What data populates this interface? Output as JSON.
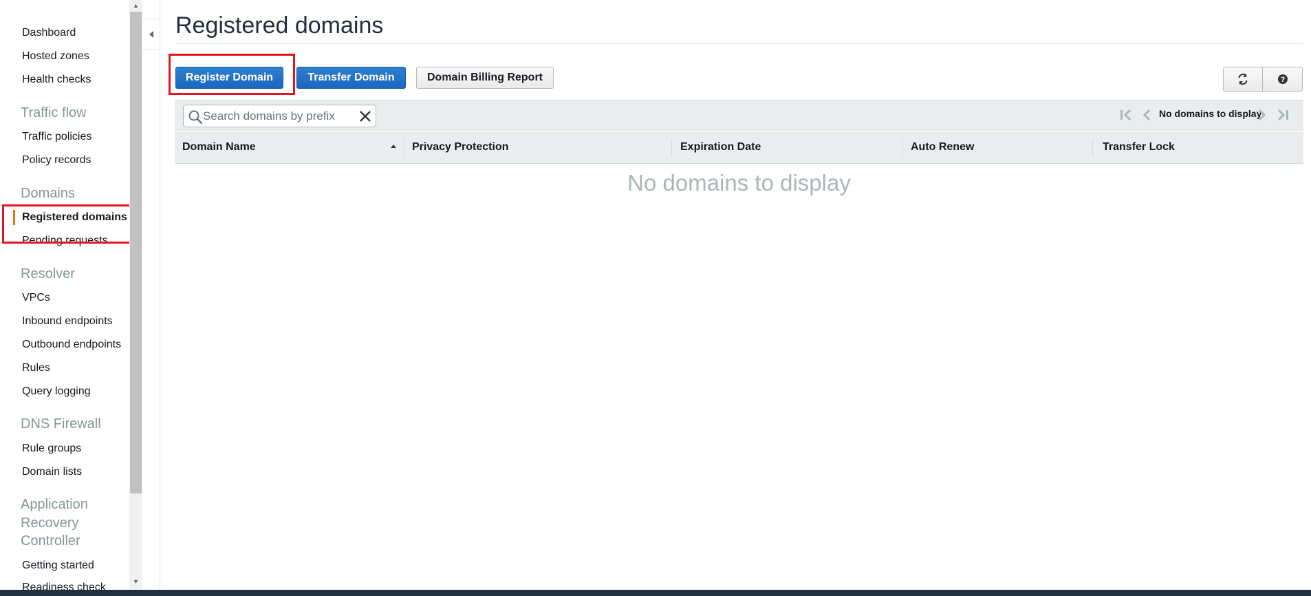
{
  "sidebar": {
    "items": [
      {
        "label": "Dashboard"
      },
      {
        "label": "Hosted zones"
      },
      {
        "label": "Health checks"
      }
    ],
    "traffic_flow": {
      "title": "Traffic flow",
      "items": [
        {
          "label": "Traffic policies"
        },
        {
          "label": "Policy records"
        }
      ]
    },
    "domains": {
      "title": "Domains",
      "items": [
        {
          "label": "Registered domains"
        },
        {
          "label": "Pending requests"
        }
      ]
    },
    "resolver": {
      "title": "Resolver",
      "items": [
        {
          "label": "VPCs"
        },
        {
          "label": "Inbound endpoints"
        },
        {
          "label": "Outbound endpoints"
        },
        {
          "label": "Rules"
        },
        {
          "label": "Query logging"
        }
      ]
    },
    "dns_firewall": {
      "title": "DNS Firewall",
      "items": [
        {
          "label": "Rule groups"
        },
        {
          "label": "Domain lists"
        }
      ]
    },
    "arc": {
      "title_lines": [
        "Application",
        "Recovery",
        "Controller"
      ],
      "items": [
        {
          "label": "Getting started"
        },
        {
          "label": "Readiness check"
        }
      ]
    },
    "active_item": "Registered domains"
  },
  "main": {
    "title": "Registered domains",
    "toolbar": {
      "register_label": "Register Domain",
      "transfer_label": "Transfer Domain",
      "billing_label": "Domain Billing Report",
      "refresh_icon": "refresh-icon",
      "help_icon": "help-icon"
    },
    "search": {
      "placeholder": "Search domains by prefix",
      "value": ""
    },
    "pager": {
      "status": "No domains to display"
    },
    "table": {
      "columns": [
        "Domain Name",
        "Privacy Protection",
        "Expiration Date",
        "Auto Renew",
        "Transfer Lock"
      ],
      "empty_message": "No domains to display",
      "rows": []
    }
  },
  "colors": {
    "primary_button": "#1a6cc0",
    "active_indicator": "#ec7211",
    "highlight": "#e3141e",
    "bottom_bar": "#232f3e"
  }
}
